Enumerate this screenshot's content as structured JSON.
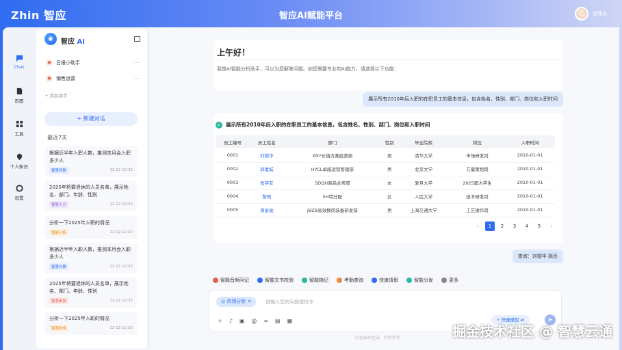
{
  "header": {
    "brand": "Zhin 智应",
    "title": "智应AI赋能平台",
    "user": "管理员"
  },
  "rail": [
    {
      "label": "Chat",
      "icon": "chat-icon"
    },
    {
      "label": "页面",
      "icon": "page-icon"
    },
    {
      "label": "工具",
      "icon": "tools-icon"
    },
    {
      "label": "个人知识",
      "icon": "knowledge-icon"
    },
    {
      "label": "设置",
      "icon": "settings-icon"
    }
  ],
  "sidebar": {
    "title_main": "智应",
    "title_ai": "AI",
    "assistants": [
      {
        "label": "日报小助手",
        "more": "···"
      },
      {
        "label": "销售运营",
        "more": "···"
      }
    ],
    "add_assistant": "+ 添加助手",
    "new_chat": "+ 新建对话",
    "recent_label": "最近7天",
    "history": [
      {
        "text": "根据近半年入职人数，推测本月会入职多少人",
        "tag": "智慧问数",
        "time": "12-12 12:32"
      },
      {
        "text": "2025年将要退休的人员名单，展示姓名、部门、年龄、性别",
        "tag": "智慧人力",
        "time": "12-12 12:32"
      },
      {
        "text": "分析一下2025年入职的情况",
        "tag": "智能分析",
        "time": "12-12 12:32"
      },
      {
        "text": "根据近半年入职人数，推测本月会入职多少人",
        "tag": "智慧问数",
        "time": "12-12 12:32"
      },
      {
        "text": "2025年将要退休的人员名单，展示姓名、部门、年龄、性别",
        "tag": "智慧审批",
        "time": "12-12 12:32"
      },
      {
        "text": "分析一下2025年入职的情况",
        "tag": "智慧财务",
        "time": "12-12 12:32"
      }
    ]
  },
  "chat": {
    "greeting": "上午好！",
    "intro": "我是AI智能分析助手，可以为您解答问题。如您需要专业的AI能力，请选择以下功能：",
    "question": "展示所有2010年后入职的在职员工的基本信息，包含姓名、性别、部门、岗位和入职时间",
    "answer_title": "展示所有2010年后入职的在职员工的基本信息，包含姓名、性别、部门、岗位和入职时间",
    "table": {
      "headers": [
        "员工编号",
        "员工姓名",
        "部门",
        "性别",
        "毕业院校",
        "岗位",
        "入职时间"
      ],
      "rows": [
        [
          "0001",
          "刘德华",
          "XNY价值方案经营部",
          "男",
          "清华大学",
          "市场研发岗",
          "2010-01-01"
        ],
        [
          "0002",
          "郭富城",
          "HYCL卓越运营管理部",
          "男",
          "北京大学",
          "方案策划岗",
          "2010-01-01"
        ],
        [
          "0003",
          "张学友",
          "SDQH商品业务部",
          "女",
          "复旦大学",
          "2025届大学生",
          "2010-01-01"
        ],
        [
          "0004",
          "黎明",
          "SH特分配",
          "女",
          "人民大学",
          "技术研发岗",
          "2010-01-01"
        ],
        [
          "0005",
          "周星驰",
          "JBZB高效换岗装备研发部",
          "男",
          "上海交通大学",
          "工艺操作岗",
          "2010-01-01"
        ]
      ]
    },
    "pages": [
      "1",
      "2",
      "3",
      "4",
      "5"
    ],
    "prev": "‹",
    "next": "›",
    "question2": "查询：刘德华 简历"
  },
  "tools": [
    {
      "label": "智能音频问记",
      "color": "#e8604c"
    },
    {
      "label": "智能文书校验",
      "color": "#2f6cf0"
    },
    {
      "label": "智能随记",
      "color": "#2bb7a3"
    },
    {
      "label": "考勤查询",
      "color": "#f08a3c"
    },
    {
      "label": "快速请假",
      "color": "#2f6cf0"
    },
    {
      "label": "智能分发",
      "color": "#2bb7a3"
    },
    {
      "label": "更多",
      "color": "#888888"
    }
  ],
  "input": {
    "chip": "市场分析",
    "placeholder": "请输入您的问题或指令",
    "model": "快速模型",
    "footer": "内容由AI生成，仅供参考"
  },
  "watermark": "掘金技术社区 @ 智慧云通"
}
